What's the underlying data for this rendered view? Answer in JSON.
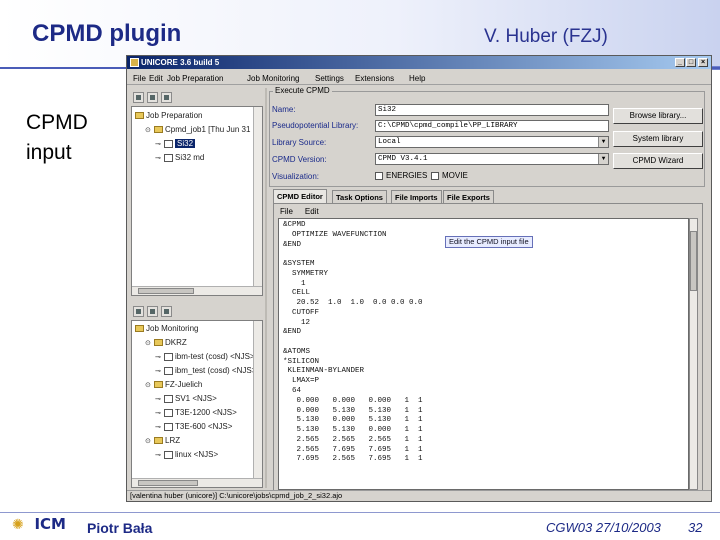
{
  "slide": {
    "title": "CPMD plugin",
    "author": "V. Huber (FZJ)",
    "side_text_line1": "CPMD",
    "side_text_line2": "input"
  },
  "window": {
    "title": "UNICORE 3.6 build 5",
    "menu": [
      "File",
      "Edit",
      "Job Preparation",
      "Job Monitoring",
      "Settings",
      "Extensions",
      "Help"
    ]
  },
  "job_preparation": {
    "root_label": "Job Preparation",
    "items": [
      {
        "label": "Cpmd_job1 [Thu Jun 31",
        "level": 1,
        "kind": "folder"
      },
      {
        "label": "Si32",
        "level": 2,
        "kind": "file",
        "selected": true
      },
      {
        "label": "Si32 md",
        "level": 2,
        "kind": "file"
      }
    ]
  },
  "job_monitoring": {
    "root_label": "Job Monitoring",
    "items": [
      {
        "label": "DKRZ",
        "level": 1,
        "kind": "folder"
      },
      {
        "label": "ibm-test (cosd) <NJS>",
        "level": 2,
        "kind": "file"
      },
      {
        "label": "ibm_test (cosd) <NJS>",
        "level": 2,
        "kind": "file"
      },
      {
        "label": "FZ-Juelich",
        "level": 1,
        "kind": "folder"
      },
      {
        "label": "SV1 <NJS>",
        "level": 2,
        "kind": "file"
      },
      {
        "label": "T3E-1200 <NJS>",
        "level": 2,
        "kind": "file"
      },
      {
        "label": "T3E-600 <NJS>",
        "level": 2,
        "kind": "file"
      },
      {
        "label": "LRZ",
        "level": 1,
        "kind": "folder"
      },
      {
        "label": "linux <NJS>",
        "level": 2,
        "kind": "file"
      }
    ]
  },
  "execute_group": {
    "title": "Execute CPMD",
    "name_label": "Name:",
    "name_value": "Si32",
    "pseudo_label": "Pseudopotential Library:",
    "pseudo_value": "C:\\CPMD\\cpmd_compile\\PP_LIBRARY",
    "source_label": "Library Source:",
    "source_value": "Local",
    "version_label": "CPMD Version:",
    "version_value": "CPMD V3.4.1",
    "visualization_label": "Visualization:",
    "checkbox_energies": "ENERGIES",
    "checkbox_movie": "MOVIE",
    "btn_browse": "Browse library...",
    "btn_system": "System library",
    "btn_wizard": "CPMD Wizard"
  },
  "tabs": [
    "CPMD Editor",
    "Task Options",
    "File Imports",
    "File Exports"
  ],
  "editor": {
    "menu": [
      "File",
      "Edit"
    ],
    "tooltip": "Edit the CPMD input file",
    "lines": [
      "&CPMD",
      "  OPTIMIZE WAVEFUNCTION",
      "&END",
      "",
      "&SYSTEM",
      "  SYMMETRY",
      "    1",
      "  CELL",
      "   20.52  1.0  1.0  0.0 0.0 0.0",
      "  CUTOFF",
      "    12",
      "&END",
      "",
      "&ATOMS",
      "*SILICON",
      " KLEINMAN-BYLANDER",
      "  LMAX=P",
      "  64",
      "   0.000   0.000   0.000   1  1",
      "   0.000   5.130   5.130   1  1",
      "   5.130   0.000   5.130   1  1",
      "   5.130   5.130   0.000   1  1",
      "   2.565   2.565   2.565   1  1",
      "   2.565   7.695   7.695   1  1",
      "   7.695   2.565   7.695   1  1"
    ]
  },
  "status": "[valentina huber (unicore)] C:\\unicore\\jobs\\cpmd_job_2_si32.ajo",
  "footer": {
    "logo": "ICM",
    "name": "Piotr Bała",
    "conference": "CGW03 27/10/2003",
    "page": "32"
  },
  "colors": {
    "title_blue": "#1d2a86",
    "window_bg": "#d6d3ce",
    "titlebar": "#0a246a"
  }
}
